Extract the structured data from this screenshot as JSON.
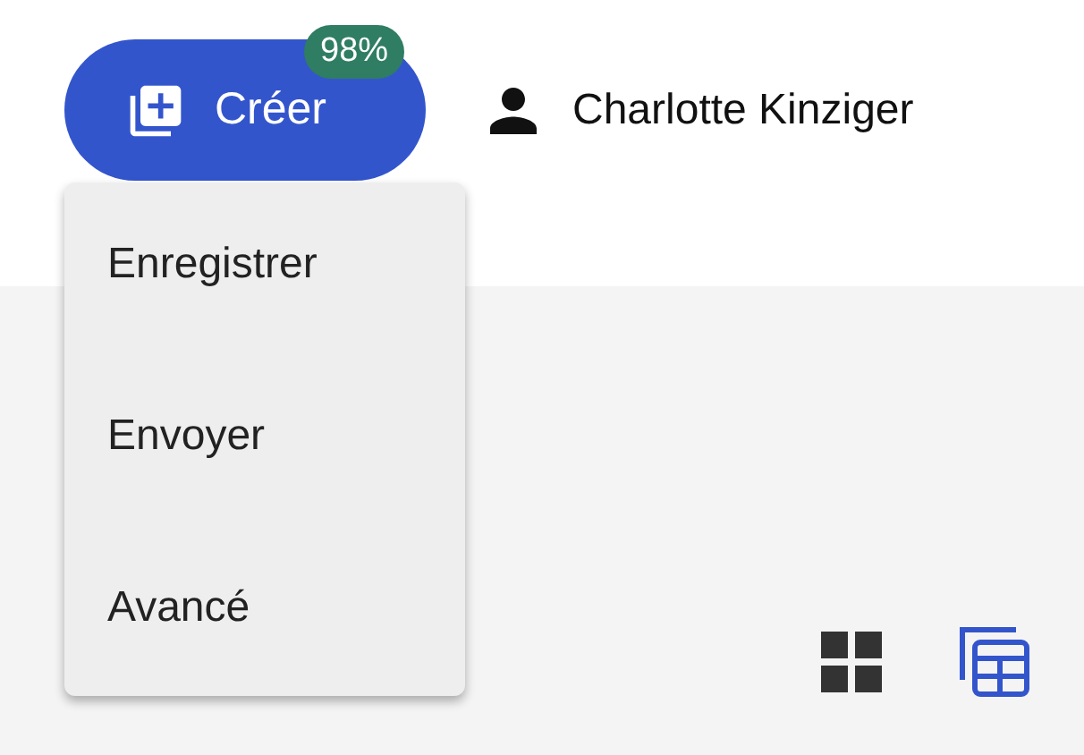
{
  "create_button": {
    "label": "Créer",
    "badge": "98%"
  },
  "user": {
    "name": "Charlotte Kinziger"
  },
  "create_menu": {
    "open": true,
    "items": [
      {
        "label": "Enregistrer"
      },
      {
        "label": "Envoyer"
      },
      {
        "label": "Avancé"
      }
    ]
  },
  "view_toggles": [
    {
      "kind": "grid",
      "selected": false
    },
    {
      "kind": "table",
      "selected": true
    }
  ]
}
